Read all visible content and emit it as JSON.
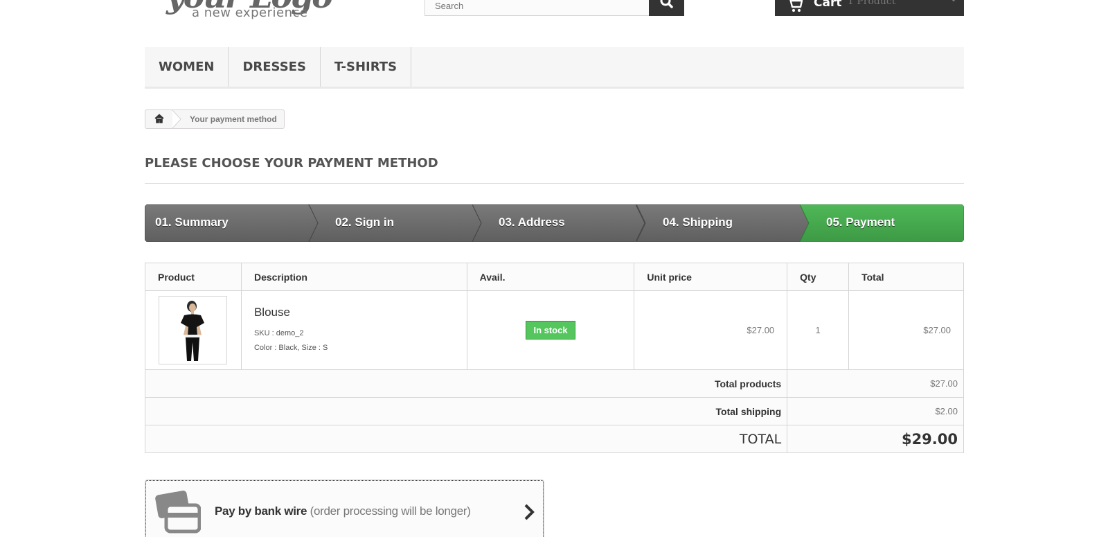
{
  "header": {
    "logo_script": "your Logo",
    "logo_tagline": "a new experience",
    "search_placeholder": "Search",
    "cart_label": "Cart",
    "cart_qty": "1 Product"
  },
  "menu": [
    "WOMEN",
    "DRESSES",
    "T-SHIRTS"
  ],
  "breadcrumb": {
    "current": "Your payment method"
  },
  "page_heading": "PLEASE CHOOSE YOUR PAYMENT METHOD",
  "steps": [
    {
      "label": "01. Summary",
      "state": "done"
    },
    {
      "label": "02. Sign in",
      "state": "done"
    },
    {
      "label": "03. Address",
      "state": "done"
    },
    {
      "label": "04. Shipping",
      "state": "done"
    },
    {
      "label": "05. Payment",
      "state": "current"
    }
  ],
  "cart_table": {
    "headers": [
      "Product",
      "Description",
      "Avail.",
      "Unit price",
      "Qty",
      "Total"
    ],
    "items": [
      {
        "name": "Blouse",
        "sku": "SKU : demo_2",
        "attributes": "Color : Black, Size : S",
        "availability": "In stock",
        "unit_price": "$27.00",
        "qty": "1",
        "total": "$27.00"
      }
    ],
    "totals": {
      "products_label": "Total products",
      "products_value": "$27.00",
      "shipping_label": "Total shipping",
      "shipping_value": "$2.00",
      "total_label": "TOTAL",
      "total_value": "$29.00"
    }
  },
  "payment_options": [
    {
      "title": "Pay by bank wire",
      "note": "(order processing will be longer)",
      "icon": "bank-card-icon"
    }
  ],
  "colors": {
    "dark": "#333333",
    "step_done": "#6f6f6f",
    "step_current": "#46a74e",
    "in_stock": "#55c65e",
    "border": "#d6d4d4"
  }
}
